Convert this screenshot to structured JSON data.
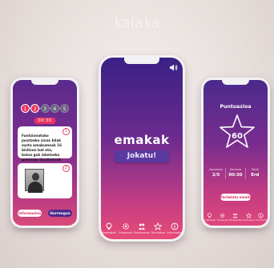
{
  "brand": {
    "logo_text": "kalaka"
  },
  "left_phone": {
    "steps": [
      "1",
      "2",
      "3",
      "4",
      "5"
    ],
    "timer": "00:30",
    "question_card": {
      "number": "1",
      "text": "Funtzionatuko jasotzeko sinas bilak zuzta emakumeak 16 bizitzen bat eta, baina guk iaketzeko gutxiago ikusitakoak"
    },
    "image_card": {
      "number": "2"
    },
    "left_button": "Informazioa",
    "right_button": "Hurrengoa"
  },
  "center_phone": {
    "title": "emakak",
    "play_button": "Jokatu!",
    "nav": [
      {
        "icon": "bulb-icon",
        "label": "Argibideak"
      },
      {
        "icon": "settings-icon",
        "label": "Ezarpenak"
      },
      {
        "icon": "people-icon",
        "label": "Emakumeak"
      },
      {
        "icon": "star-icon",
        "label": "Puntuazioa"
      },
      {
        "icon": "info-icon",
        "label": "Informazioa"
      }
    ]
  },
  "right_phone": {
    "title": "Puntuazioa",
    "score": "60",
    "stats": [
      {
        "label": "Asmatuak",
        "value": "2/5"
      },
      {
        "label": "Denbora",
        "value": "00:30"
      },
      {
        "label": "Maila",
        "value": "Erd"
      }
    ],
    "share_button": "Partekatu emaitza",
    "nav": [
      {
        "icon": "bulb-icon",
        "label": "Argibideak"
      },
      {
        "icon": "settings-icon",
        "label": "Ezarpenak"
      },
      {
        "icon": "people-icon",
        "label": "Emakumeak"
      },
      {
        "icon": "star-icon",
        "label": "Puntuazioa"
      },
      {
        "icon": "info-icon",
        "label": "Informazioa"
      }
    ]
  },
  "colors": {
    "accent_pink": "#e8355f",
    "purple_top": "#3a2185",
    "magenta_bottom": "#e84b78",
    "background": "#ebe3e0"
  }
}
